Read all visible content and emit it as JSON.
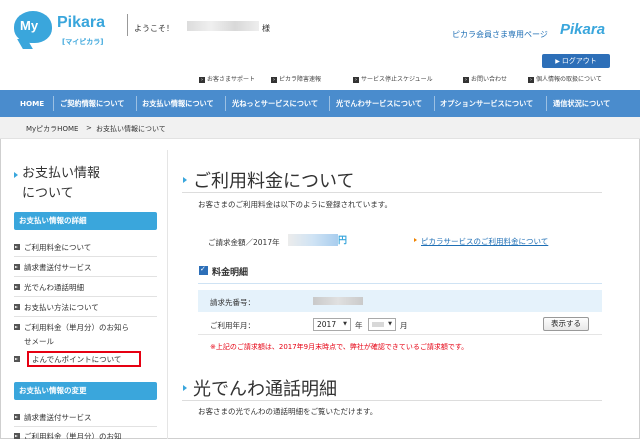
{
  "header": {
    "logo_main": "My",
    "logo_brand": "Pikara",
    "logo_sub": "[マイピカラ]",
    "welcome": "ようこそ！",
    "welcome_suffix": "様",
    "member_page": "ピカラ会員さま専用ページ",
    "brand_right": "Pikara",
    "logout": "ログアウト",
    "util_links": [
      "お客さまサポート",
      "ピカラ障害速報",
      "サービス停止スケジュール",
      "お問い合わせ",
      "個人情報の取扱について"
    ]
  },
  "nav": {
    "items": [
      "HOME",
      "ご契約情報について",
      "お支払い情報について",
      "光ねっとサービスについて",
      "光でんわサービスについて",
      "オプションサービスについて",
      "通信状況について"
    ]
  },
  "breadcrumb": {
    "home": "MyピカラHOME",
    "sep": ">",
    "current": "お支払い情報について"
  },
  "sidebar": {
    "title_line1": "お支払い情報",
    "title_line2": "について",
    "section1": "お支払い情報の詳細",
    "items1": [
      "ご利用料金について",
      "請求書送付サービス",
      "光でんわ通話明細",
      "お支払い方法について",
      "ご利用料金（単月分）のお知ら",
      "せメール",
      "よんでんポイントについて"
    ],
    "section2": "お支払い情報の変更",
    "items2": [
      "請求書送付サービス",
      "ご利用料金（単月分）のお知"
    ]
  },
  "main": {
    "title": "ご利用料金について",
    "desc": "お客さまのご利用料金は以下のように登録されています。",
    "amount_label": "ご請求金額／2017年",
    "amount_unit": "円",
    "service_link": "ピカラサービスのご利用料金について",
    "detail_title": "料金明細",
    "billing_label": "請求先番号：",
    "month_label": "ご利用年月：",
    "year_value": "2017",
    "year_unit": "年",
    "month_unit": "月",
    "show_button": "表示する",
    "warning": "※上記のご請求額は、2017年9月末時点で、弊社が確認できているご請求額です。",
    "section2_title": "光でんわ通話明細",
    "section2_desc": "お客さまの光でんわの通話明細をご覧いただけます。"
  },
  "colors": {
    "nav_bg": "#4a8ccd",
    "accent": "#3aa6dc",
    "logout_bg": "#2d6fb8",
    "warning": "#e60012",
    "highlight_border": "#e60012"
  }
}
